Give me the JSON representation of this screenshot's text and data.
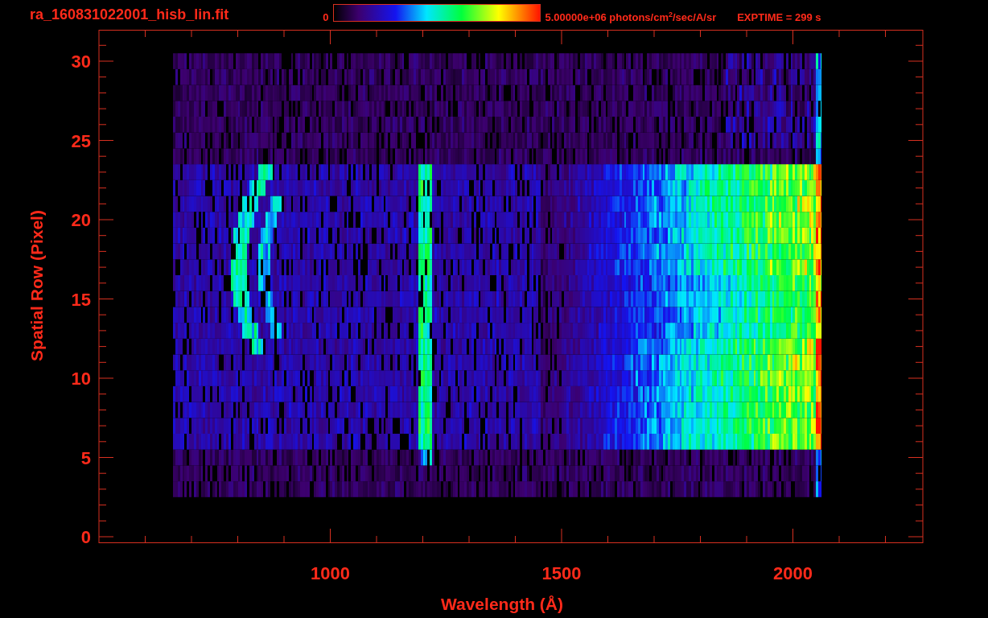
{
  "title": "ra_160831022001_hisb_lin.fit",
  "colorbar": {
    "min_label": "0",
    "max_label": "5.00000e+06 photons/cm$^{2}$/sec/A/sr"
  },
  "exposure": "EXPTIME = 299 s",
  "plot": {
    "xlabel": "Wavelength (Å)",
    "ylabel": "Spatial Row (Pixel)",
    "xticks": [
      "1000",
      "1500",
      "2000"
    ],
    "yticks": [
      "30",
      "25",
      "20",
      "15",
      "10",
      "5",
      "0"
    ]
  }
}
